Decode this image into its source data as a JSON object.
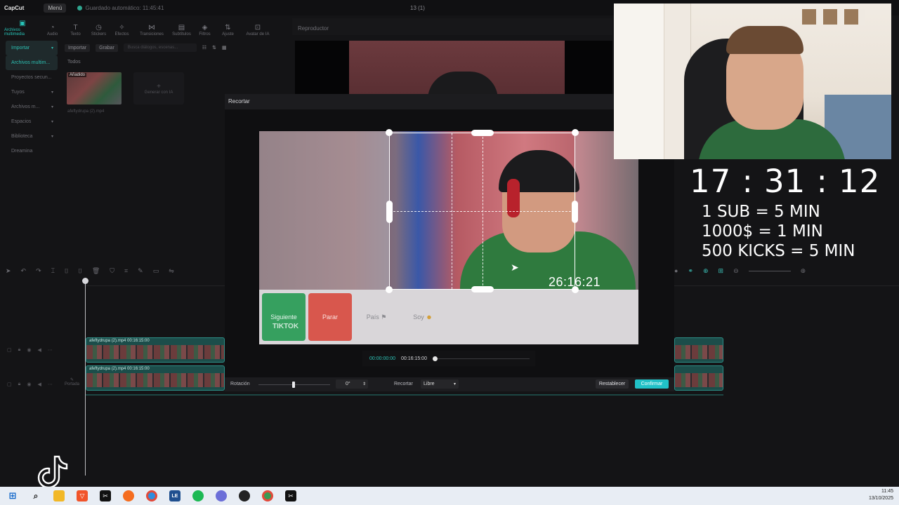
{
  "titlebar": {
    "app_name": "CapCut",
    "menu": "Menú",
    "autosave": "Guardado automático: 11:45:41",
    "project_name": "13 (1)"
  },
  "toolbar": [
    {
      "label": "Archivos multimedia",
      "icon": "media-icon"
    },
    {
      "label": "Audio",
      "icon": "audio-icon"
    },
    {
      "label": "Texto",
      "icon": "text-icon"
    },
    {
      "label": "Stickers",
      "icon": "sticker-icon"
    },
    {
      "label": "Efectos",
      "icon": "effects-icon"
    },
    {
      "label": "Transiciones",
      "icon": "transitions-icon"
    },
    {
      "label": "Subtítulos",
      "icon": "subtitles-icon"
    },
    {
      "label": "Filtros",
      "icon": "filters-icon"
    },
    {
      "label": "Ajuste",
      "icon": "adjust-icon"
    },
    {
      "label": "Avatar de IA",
      "icon": "avatar-icon"
    }
  ],
  "sidebar": [
    {
      "label": "Importar"
    },
    {
      "label": "Archivos multim..."
    },
    {
      "label": "Proyectos secun..."
    },
    {
      "label": "Tuyos"
    },
    {
      "label": "Archivos m..."
    },
    {
      "label": "Espacios"
    },
    {
      "label": "Biblioteca"
    },
    {
      "label": "Dreamina"
    }
  ],
  "media": {
    "import_label": "Importar",
    "record_label": "Grabar",
    "search_placeholder": "Busca diálogos, escenas...",
    "section": "Todos",
    "thumb_tag": "Añadido",
    "thumb_name": "afeftydrupa (2).mp4",
    "generate_ai": "Generar con IA"
  },
  "player": {
    "title": "Reproductor"
  },
  "crop": {
    "title": "Recortar",
    "overlay_time": "26:16:21",
    "buttons": {
      "next": "Siguiente",
      "stop": "Parar",
      "country": "País",
      "soy": "Soy"
    },
    "watermark": "TIKTOK",
    "current_time": "00:00:00:00",
    "total_time": "00:16:15:00",
    "rotation_label": "Rotación",
    "rotation_value": "0°",
    "crop_label": "Recortar",
    "crop_ratio": "Libre",
    "reset": "Restablecer",
    "confirm": "Confirmar"
  },
  "timeline": {
    "clip1_name": "afeftydrupa (2).mp4   00:16:15:00",
    "clip2_name": "afeftydrupa (2).mp4   00:16:15:00",
    "cover": "Portada"
  },
  "stream": {
    "timer": "17 : 31 : 12",
    "line1": "1 SUB = 5 MIN",
    "line2": "1000$ = 1 MIN",
    "line3": "500 KICKS = 5 MIN"
  },
  "taskbar": {
    "apps": [
      "start-icon",
      "search-icon",
      "files-icon",
      "brave-icon",
      "capcut-icon",
      "firefox-icon",
      "chrome-icon",
      "le-icon",
      "spotify-icon",
      "discord-icon",
      "obs-icon",
      "chrome-2-icon",
      "capcut-2-icon"
    ],
    "time": "11:45",
    "date": "13/10/2025"
  },
  "colors": {
    "accent": "#27c4b8",
    "confirm": "#21c1c7",
    "next_btn": "#36a05f",
    "stop_btn": "#d8574d"
  }
}
